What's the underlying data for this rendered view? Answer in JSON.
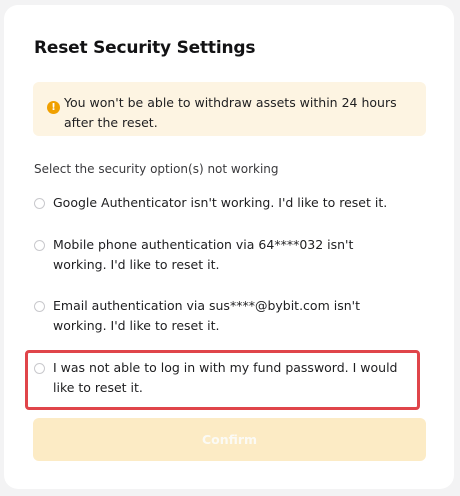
{
  "dialog": {
    "title": "Reset Security Settings"
  },
  "notice": {
    "icon": "info-icon",
    "icon_glyph": "!",
    "text": "You won't be able to withdraw assets within 24 hours after the reset."
  },
  "prompt": "Select the security option(s) not working",
  "options": [
    {
      "label": "Google Authenticator isn't working. I'd like to reset it.",
      "checked": false
    },
    {
      "label": "Mobile phone authentication via 64****032 isn't working. I'd like to reset it.",
      "checked": false
    },
    {
      "label": "Email authentication via sus****@bybit.com isn't working. I'd like to reset it.",
      "checked": false
    },
    {
      "label": "I was not able to log in with my fund password. I would like to reset it.",
      "checked": false
    }
  ],
  "confirm_label": "Confirm",
  "colors": {
    "notice_bg": "#fdf4e2",
    "notice_icon": "#f0a000",
    "highlight_border": "#e0454a",
    "confirm_disabled_bg": "#fcebc5"
  }
}
